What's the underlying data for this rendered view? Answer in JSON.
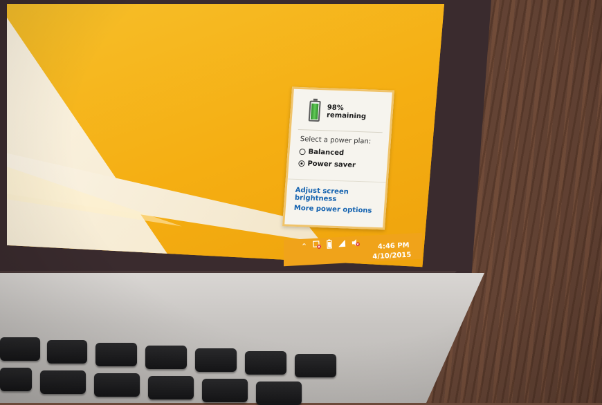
{
  "flyout": {
    "battery_percent": 98,
    "battery_text": "98% remaining",
    "plan_title": "Select a power plan:",
    "plans": [
      {
        "label": "Balanced",
        "selected": false
      },
      {
        "label": "Power saver",
        "selected": true
      }
    ],
    "links": {
      "brightness": "Adjust screen brightness",
      "more_options": "More power options"
    }
  },
  "taskbar": {
    "time": "4:46 PM",
    "date": "4/10/2015",
    "tray_icons": [
      "chevron-up-icon",
      "network-disconnected-icon",
      "battery-icon",
      "signal-icon",
      "volume-muted-icon"
    ]
  },
  "colors": {
    "wallpaper": "#f5ae12",
    "accent_border": "#f0c36a",
    "link": "#1563b0",
    "battery": "#3fae36"
  }
}
